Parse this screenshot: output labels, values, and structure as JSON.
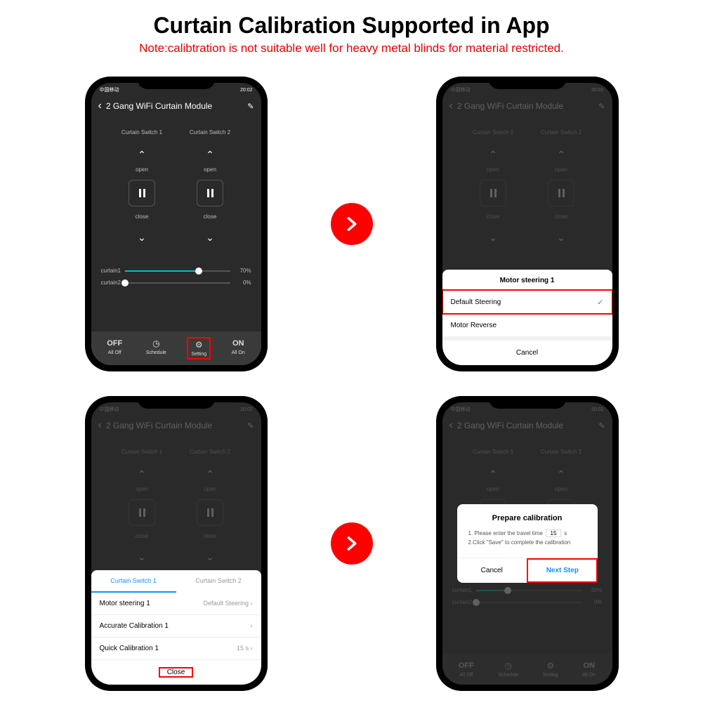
{
  "title": "Curtain Calibration Supported in App",
  "note": "Note:calibtration is not suitable well for heavy metal blinds for material restricted.",
  "statusbar": {
    "left": "中国移动",
    "right": "20:02",
    "icons": "⚡ ⇅ ⚞"
  },
  "header": {
    "title": "2 Gang WiFi Curtain Module"
  },
  "switches": {
    "s1": {
      "label": "Curtain Switch 1",
      "open": "open",
      "close": "close"
    },
    "s2": {
      "label": "Curtain Switch 2",
      "open": "open",
      "close": "close"
    }
  },
  "sliders": {
    "c1": {
      "label": "curtain1",
      "val": "70%",
      "pct": 70
    },
    "c2": {
      "label": "curtain2",
      "val": "0%",
      "pct": 0
    },
    "c1b": {
      "label": "curtain1",
      "val": "30%",
      "pct": 30
    }
  },
  "bottombar": {
    "off": {
      "top": "OFF",
      "label": "All Off"
    },
    "schedule": {
      "label": "Schedule"
    },
    "setting": {
      "label": "Setting"
    },
    "on": {
      "top": "ON",
      "label": "All On"
    }
  },
  "sheet_steering": {
    "title": "Motor steering 1",
    "opt1": "Default Steering",
    "opt2": "Motor Reverse",
    "cancel": "Cancel"
  },
  "sheet_cal": {
    "tab1": "Curtain Switch 1",
    "tab2": "Curtain Switch 2",
    "r1": {
      "label": "Motor steering 1",
      "val": "Default Steering"
    },
    "r2": {
      "label": "Accurate Calibration 1",
      "val": ""
    },
    "r3": {
      "label": "Quick Calibration 1",
      "val": "15 s"
    },
    "close": "Close"
  },
  "modal": {
    "title": "Prepare calibration",
    "line1a": "1. Please enter the travel time ",
    "line1b": " s",
    "travel_time": "15",
    "line2": "2.Click \"Save\" to complete the calibration",
    "cancel": "Cancel",
    "next": "Next Step"
  }
}
